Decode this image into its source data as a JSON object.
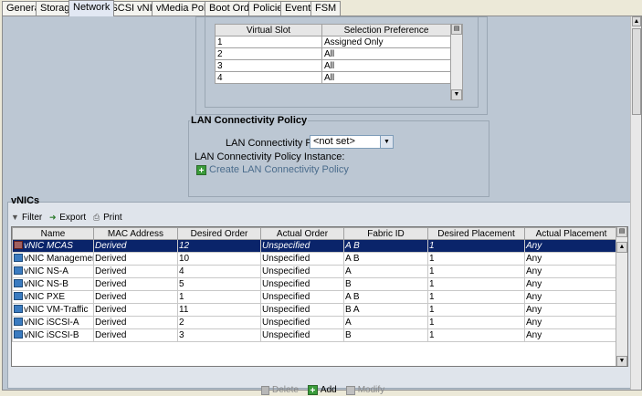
{
  "tabs": [
    "General",
    "Storage",
    "Network",
    "iSCSI vNICs",
    "vMedia Policy",
    "Boot Order",
    "Policies",
    "Events",
    "FSM"
  ],
  "active_tab": "Network",
  "slot_table": {
    "headers": [
      "Virtual Slot",
      "Selection Preference"
    ],
    "rows": [
      [
        "1",
        "Assigned Only"
      ],
      [
        "2",
        "All"
      ],
      [
        "3",
        "All"
      ],
      [
        "4",
        "All"
      ]
    ]
  },
  "lan": {
    "legend": "LAN Connectivity Policy",
    "policy_label": "LAN Connectivity Policy:",
    "policy_value": "<not set>",
    "instance_label": "LAN Connectivity Policy Instance:",
    "create_label": "Create LAN Connectivity Policy"
  },
  "vnics": {
    "title": "vNICs",
    "toolbar": {
      "filter": "Filter",
      "export": "Export",
      "print": "Print"
    },
    "headers": [
      "Name",
      "MAC Address",
      "Desired Order",
      "Actual Order",
      "Fabric ID",
      "Desired Placement",
      "Actual Placement"
    ],
    "rows": [
      [
        "vNIC MCAS",
        "Derived",
        "12",
        "Unspecified",
        "A B",
        "1",
        "Any"
      ],
      [
        "vNIC Management",
        "Derived",
        "10",
        "Unspecified",
        "A B",
        "1",
        "Any"
      ],
      [
        "vNIC NS-A",
        "Derived",
        "4",
        "Unspecified",
        "A",
        "1",
        "Any"
      ],
      [
        "vNIC NS-B",
        "Derived",
        "5",
        "Unspecified",
        "B",
        "1",
        "Any"
      ],
      [
        "vNIC PXE",
        "Derived",
        "1",
        "Unspecified",
        "A B",
        "1",
        "Any"
      ],
      [
        "vNIC VM-Traffic",
        "Derived",
        "11",
        "Unspecified",
        "B A",
        "1",
        "Any"
      ],
      [
        "vNIC iSCSI-A",
        "Derived",
        "2",
        "Unspecified",
        "A",
        "1",
        "Any"
      ],
      [
        "vNIC iSCSI-B",
        "Derived",
        "3",
        "Unspecified",
        "B",
        "1",
        "Any"
      ]
    ],
    "actions": {
      "delete": "Delete",
      "add": "Add",
      "modify": "Modify"
    }
  }
}
